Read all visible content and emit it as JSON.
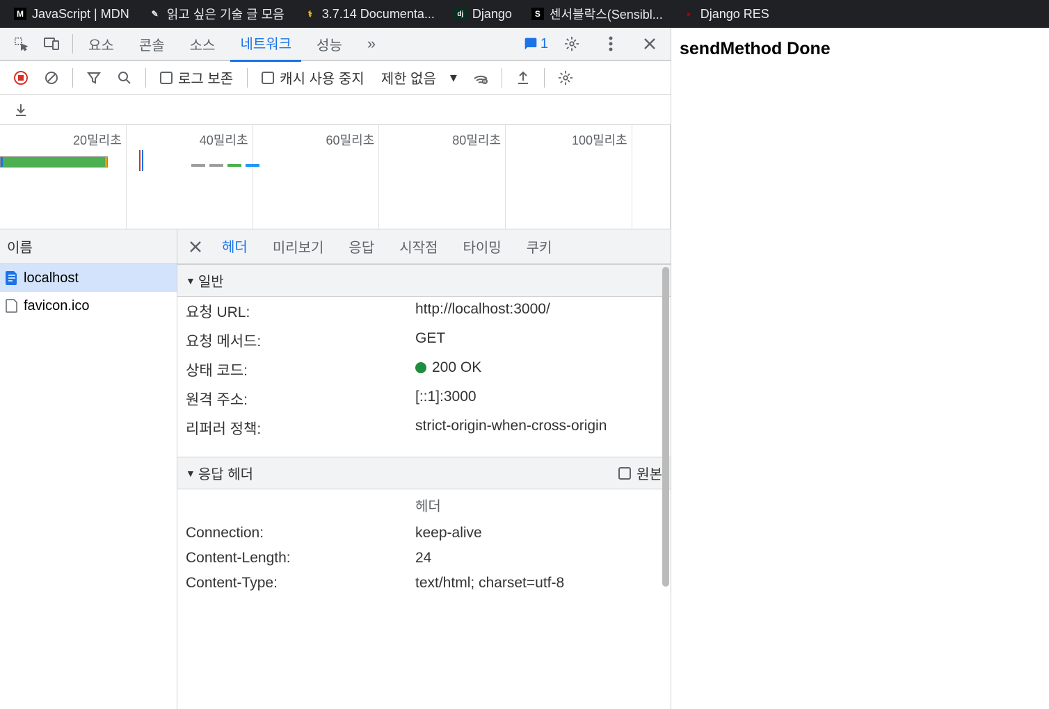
{
  "browser_tabs": [
    {
      "favicon": "M",
      "label": "JavaScript | MDN"
    },
    {
      "favicon": "✎",
      "label": "읽고 싶은 기술 글 모음"
    },
    {
      "favicon": "🐍",
      "label": "3.7.14 Documenta..."
    },
    {
      "favicon": "dj",
      "label": "Django"
    },
    {
      "favicon": "S",
      "label": "센서블락스(Sensibl..."
    },
    {
      "favicon": "●",
      "label": "Django RES"
    }
  ],
  "page_content": "sendMethod Done",
  "devtools": {
    "panels": [
      "요소",
      "콘솔",
      "소스",
      "네트워크",
      "성능"
    ],
    "active_panel": "네트워크",
    "issues_count": "1",
    "network": {
      "preserve_log": "로그 보존",
      "disable_cache": "캐시 사용 중지",
      "throttling": "제한 없음",
      "timeline_labels": [
        "20밀리초",
        "40밀리초",
        "60밀리초",
        "80밀리초",
        "100밀리초"
      ],
      "list_header": "이름",
      "requests": [
        {
          "name": "localhost",
          "selected": true
        },
        {
          "name": "favicon.ico",
          "selected": false
        }
      ],
      "detail": {
        "tabs": [
          "헤더",
          "미리보기",
          "응답",
          "시작점",
          "타이밍",
          "쿠키"
        ],
        "active_tab": "헤더",
        "general_section": "일반",
        "general": {
          "request_url_label": "요청 URL:",
          "request_url": "http://localhost:3000/",
          "method_label": "요청 메서드:",
          "method": "GET",
          "status_label": "상태 코드:",
          "status": "200 OK",
          "remote_label": "원격 주소:",
          "remote": "[::1]:3000",
          "referrer_label": "리퍼러 정책:",
          "referrer": "strict-origin-when-cross-origin"
        },
        "response_headers_section": "응답 헤더",
        "raw_label": "원본",
        "header_sub": "헤더",
        "response_headers": [
          {
            "key": "Connection:",
            "value": "keep-alive"
          },
          {
            "key": "Content-Length:",
            "value": "24"
          },
          {
            "key": "Content-Type:",
            "value": "text/html; charset=utf-8"
          }
        ]
      }
    }
  }
}
